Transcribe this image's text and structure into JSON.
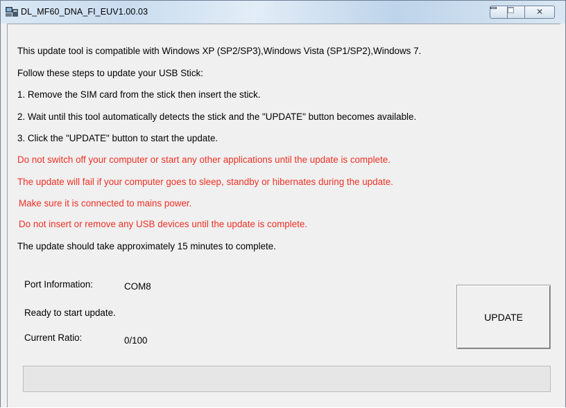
{
  "window": {
    "title": "DL_MF60_DNA_FI_EUV1.00.03",
    "close_glyph": "✕",
    "icons": [
      "app-icon",
      "minimize-icon",
      "maximize-icon",
      "close-icon"
    ]
  },
  "instructions": [
    {
      "text": "This update tool is compatible with Windows XP (SP2/SP3),Windows Vista (SP1/SP2),Windows 7.",
      "color": "#000000"
    },
    {
      "text": "Follow these steps to update your USB Stick:",
      "color": "#000000"
    },
    {
      "text": "1. Remove the SIM card from the stick then insert the stick.",
      "color": "#000000"
    },
    {
      "text": "2. Wait until this tool automatically detects the stick and the \"UPDATE\" button becomes available.",
      "color": "#000000"
    },
    {
      "text": "3. Click the \"UPDATE\" button to start the update.",
      "color": "#000000"
    },
    {
      "text": "Do not switch off your computer or start any other applications until the update is complete.",
      "color": "#ee3024"
    },
    {
      "text": "The update will fail if your computer goes to sleep, standby or hibernates during the update.",
      "color": "#ee3024"
    },
    {
      "text": "Make sure it is connected to mains power.",
      "color": "#ee3024"
    },
    {
      "text": "Do not insert or remove any USB devices until the update is complete.",
      "color": "#ee3024"
    },
    {
      "text": "The update should take approximately 15 minutes to complete.",
      "color": "#000000"
    }
  ],
  "status": {
    "port_label": "Port Information:",
    "port_value": "COM8",
    "ready_text": "Ready to start update.",
    "ratio_label": "Current Ratio:",
    "ratio_value": "0/100"
  },
  "update_button": {
    "label": "UPDATE"
  },
  "progress": {
    "value": 0,
    "max": 100
  }
}
